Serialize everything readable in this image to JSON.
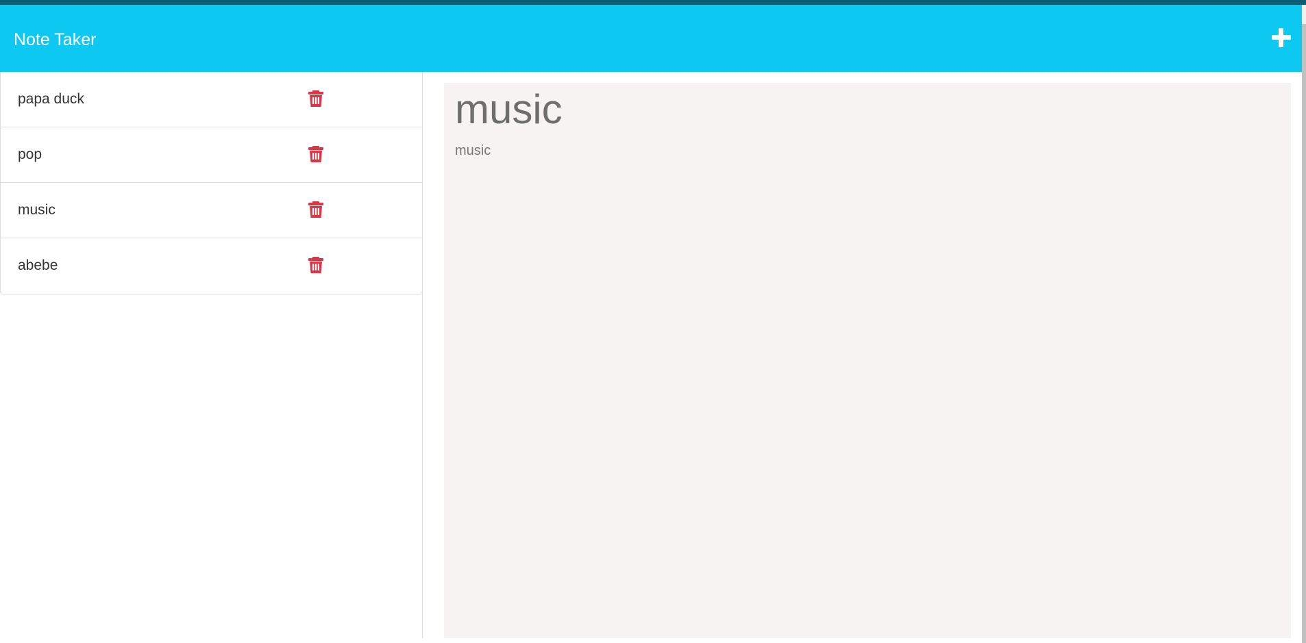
{
  "app": {
    "title": "Note Taker",
    "accent_color": "#0dc8f0",
    "add_icon": "plus-icon"
  },
  "notes": [
    {
      "title": "papa duck",
      "delete_icon": "trash-icon"
    },
    {
      "title": "pop",
      "delete_icon": "trash-icon"
    },
    {
      "title": "music",
      "delete_icon": "trash-icon"
    },
    {
      "title": "abebe",
      "delete_icon": "trash-icon"
    }
  ],
  "active_note": {
    "title": "music",
    "text": "music"
  },
  "colors": {
    "delete": "#dc3545",
    "editor_bg": "#f6f3f2"
  }
}
